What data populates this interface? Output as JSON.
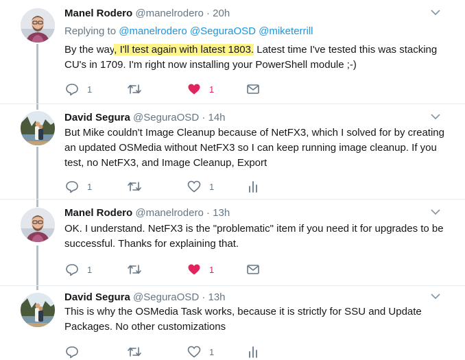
{
  "tweets": [
    {
      "name": "Manel Rodero",
      "handle": "@manelrodero",
      "time": "20h",
      "replying_prefix": "Replying to ",
      "mentions": [
        "@manelrodero",
        "@SeguraOSD",
        "@miketerrill"
      ],
      "text_before": "By the way",
      "text_highlight": ", I'll test again with latest 1803.",
      "text_after": " Latest time I've tested this was stacking CU's in 1709. I'm right now installing your PowerShell module ;-)",
      "actions": {
        "reply_count": "1",
        "retweet_count": "",
        "like_count": "1",
        "liked": true,
        "extra": "mail-icon"
      }
    },
    {
      "name": "David Segura",
      "handle": "@SeguraOSD",
      "time": "14h",
      "text": "But Mike couldn't Image Cleanup because of NetFX3, which I solved for by creating an updated OSMedia without NetFX3 so I can keep running image cleanup. If you test, no NetFX3, and Image Cleanup, Export",
      "actions": {
        "reply_count": "1",
        "retweet_count": "",
        "like_count": "1",
        "liked": false,
        "extra": "analytics-icon"
      }
    },
    {
      "name": "Manel Rodero",
      "handle": "@manelrodero",
      "time": "13h",
      "text": "OK. I understand. NetFX3 is the \"problematic\" item if you need it for upgrades to be successful. Thanks for explaining that.",
      "actions": {
        "reply_count": "1",
        "retweet_count": "",
        "like_count": "1",
        "liked": true,
        "extra": "mail-icon"
      }
    },
    {
      "name": "David Segura",
      "handle": "@SeguraOSD",
      "time": "13h",
      "text": "This is why the OSMedia Task works, because it is strictly for SSU and Update Packages.  No other customizations",
      "actions": {
        "reply_count": "",
        "retweet_count": "",
        "like_count": "1",
        "liked": false,
        "extra": "analytics-icon"
      }
    }
  ],
  "colors": {
    "link": "#1b95e0",
    "muted": "#657786",
    "like": "#e0245e",
    "thread_line": "#aebfd2",
    "highlight": "#fff48a"
  }
}
